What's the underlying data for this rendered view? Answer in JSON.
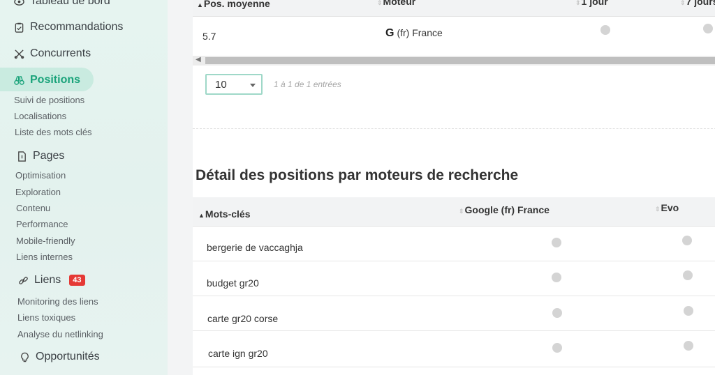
{
  "sidebar": {
    "dashboard_label": "Tableau de bord",
    "recommendations_label": "Recommandations",
    "competitors_label": "Concurrents",
    "positions_label": "Positions",
    "positions_sub": [
      "Suivi de positions",
      "Localisations",
      "Liste des mots clés"
    ],
    "pages_label": "Pages",
    "pages_sub": [
      "Optimisation",
      "Exploration",
      "Contenu",
      "Performance",
      "Mobile-friendly",
      "Liens internes"
    ],
    "links_label": "Liens",
    "links_badge": "43",
    "links_sub": [
      "Monitoring des liens",
      "Liens toxiques",
      "Analyse du netlinking"
    ],
    "opportunities_label": "Opportunités",
    "accent_color": "#1aa37a",
    "badge_color": "#e53935",
    "icons": [
      "eye-icon",
      "clipboard-check-icon",
      "competitors-icon",
      "binoculars-icon",
      "page-icon",
      "link-icon",
      "lightbulb-icon"
    ]
  },
  "summary_table": {
    "headers": [
      "Pos. moyenne",
      "Moteur",
      "1 jour",
      "7 jours"
    ],
    "row": {
      "avg_position": "5.7",
      "engine": "(fr) France"
    }
  },
  "pagination": {
    "page_size": "10",
    "entries_text": "1 à 1 de 1 entrées"
  },
  "detail": {
    "title": "Détail des positions par moteurs de recherche",
    "headers": [
      "Mots-clés",
      "Google (fr) France",
      "Evo"
    ],
    "rows": [
      {
        "keyword": "bergerie de vaccaghja"
      },
      {
        "keyword": "budget gr20"
      },
      {
        "keyword": "carte gr20 corse"
      },
      {
        "keyword": "carte ign gr20"
      }
    ]
  }
}
